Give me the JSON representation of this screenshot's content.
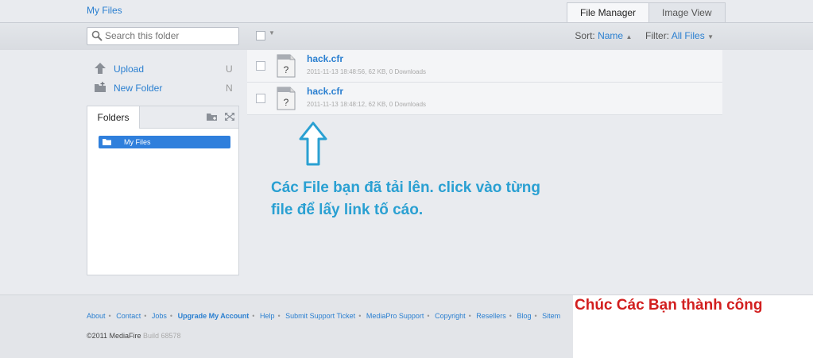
{
  "header": {
    "breadcrumb": "My Files",
    "tabs": [
      {
        "label": "File Manager",
        "active": true
      },
      {
        "label": "Image View",
        "active": false
      }
    ]
  },
  "toolbar": {
    "search_placeholder": "Search this folder",
    "sort_label": "Sort:",
    "sort_value": "Name",
    "filter_label": "Filter:",
    "filter_value": "All Files"
  },
  "sidebar": {
    "actions": [
      {
        "label": "Upload",
        "key": "U",
        "icon": "upload-arrow-icon"
      },
      {
        "label": "New Folder",
        "key": "N",
        "icon": "new-folder-icon"
      }
    ],
    "folders_tab": "Folders",
    "tree": [
      {
        "label": "My Files",
        "selected": true
      }
    ]
  },
  "files": [
    {
      "name": "hack.cfr",
      "meta": "2011-11-13 18:48:56, 62 KB, 0 Downloads"
    },
    {
      "name": "hack.cfr",
      "meta": "2011-11-13 18:48:12, 62 KB, 0 Downloads"
    }
  ],
  "annotation": {
    "line1": "Các File bạn đã tải lên. click vào từng",
    "line2": "file để lấy link tố cáo.",
    "color": "#2aa0d2"
  },
  "footer": {
    "links": [
      "About",
      "Contact",
      "Jobs",
      "Upgrade My Account",
      "Help",
      "Submit Support Ticket",
      "MediaPro Support",
      "Copyright",
      "Resellers",
      "Blog",
      "Sitem"
    ],
    "copyright": "©2011 MediaFire",
    "build": "Build 68578",
    "note": "Chúc Các Bạn thành công",
    "note_color": "#d21f1f"
  },
  "colors": {
    "link": "#2a7fd0",
    "selected": "#2f7fdc"
  }
}
